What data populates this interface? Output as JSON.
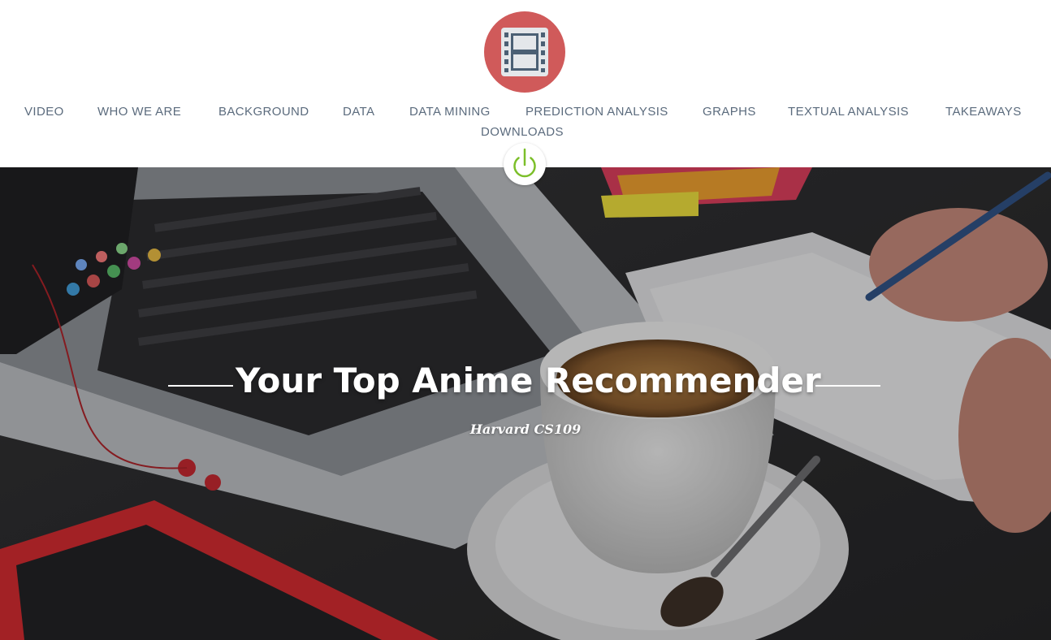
{
  "header": {
    "logo_icon": "film-strip-icon",
    "logo_color": "#d05a5a"
  },
  "nav": {
    "items": [
      {
        "label": "VIDEO"
      },
      {
        "label": "WHO WE ARE"
      },
      {
        "label": "BACKGROUND"
      },
      {
        "label": "DATA"
      },
      {
        "label": "DATA MINING"
      },
      {
        "label": "PREDICTION ANALYSIS"
      },
      {
        "label": "GRAPHS"
      },
      {
        "label": "TEXTUAL ANALYSIS"
      },
      {
        "label": "TAKEAWAYS"
      },
      {
        "label": "DOWNLOADS"
      }
    ],
    "text_color": "#5b6b7d"
  },
  "power_button": {
    "icon": "power-icon",
    "color": "#7cbf2a"
  },
  "hero": {
    "title": "Your Top Anime Recommender",
    "subtitle": "Harvard CS109",
    "background_description_icon": "laptop-coffee-notebook-photo"
  }
}
